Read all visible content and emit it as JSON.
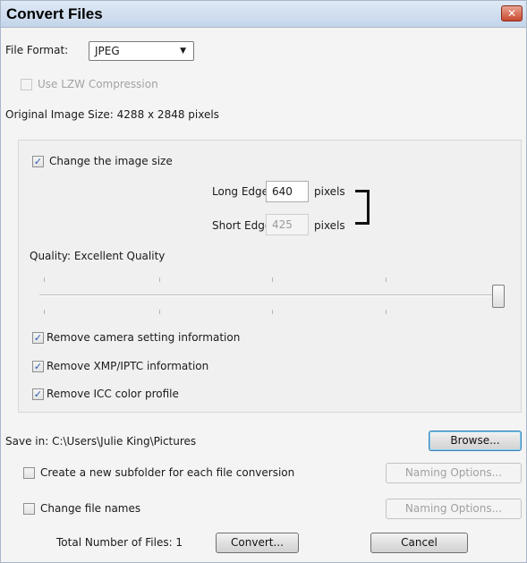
{
  "window": {
    "title": "Convert Files",
    "close_icon": "close-icon"
  },
  "format": {
    "label": "File Format:",
    "selected": "JPEG"
  },
  "lzw": {
    "label": "Use LZW Compression",
    "checked": false,
    "enabled": false
  },
  "original_size": "Original Image Size: 4288 x 2848 pixels",
  "resize": {
    "label": "Change the image size",
    "checked": true,
    "long_edge_label": "Long Edge:",
    "long_edge_value": "640",
    "long_edge_unit": "pixels",
    "short_edge_label": "Short Edge:",
    "short_edge_value": "425",
    "short_edge_unit": "pixels"
  },
  "quality": {
    "label": "Quality: Excellent Quality",
    "level": 1.0
  },
  "options": [
    {
      "label": "Remove camera setting information",
      "checked": true
    },
    {
      "label": "Remove XMP/IPTC information",
      "checked": true
    },
    {
      "label": "Remove ICC color profile",
      "checked": true
    }
  ],
  "save": {
    "label": "Save in: C:\\Users\\Julie King\\Pictures",
    "browse": "Browse..."
  },
  "subfolder": {
    "label": "Create a new subfolder for each file conversion",
    "checked": false,
    "naming": "Naming Options..."
  },
  "rename": {
    "label": "Change file names",
    "checked": false,
    "naming": "Naming Options..."
  },
  "footer": {
    "total": "Total Number of Files: 1",
    "convert": "Convert...",
    "cancel": "Cancel"
  },
  "check_glyph": "✓"
}
